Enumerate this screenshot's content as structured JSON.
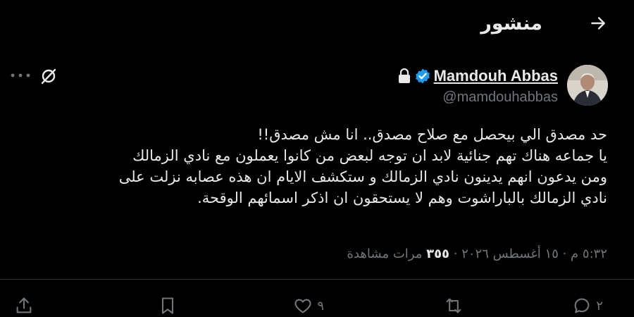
{
  "header": {
    "title": "منشور",
    "back_icon": "arrow-right-icon"
  },
  "author": {
    "name": "Mamdouh Abbas",
    "handle": "@mamdouhabbas",
    "verified_color": "#1d9bf0"
  },
  "tweet": {
    "text": "حد مصدق الي بيحصل مع صلاح مصدق.. انا مش مصدق!!\nيا جماعه هناك تهم جنائية لابد ان توجه لبعض من كانوا يعملون مع نادي الزمالك\nومن يدعون انهم يدينون نادي الزمالك و ستكشف الايام ان هذه عصابه نزلت على\nنادي الزمالك بالباراشوت وهم لا يستحقون ان اذكر اسمائهم الوقحة."
  },
  "meta": {
    "time": "٥:٣٢ م",
    "sep1": " · ",
    "date": "١٥ أغسطس ٢٠٢٦",
    "sep2": " · ",
    "views_count": "٣٥٥",
    "views_label": " مرات مشاهدة"
  },
  "actions": {
    "reply_count": "٢",
    "like_count": "٩"
  }
}
